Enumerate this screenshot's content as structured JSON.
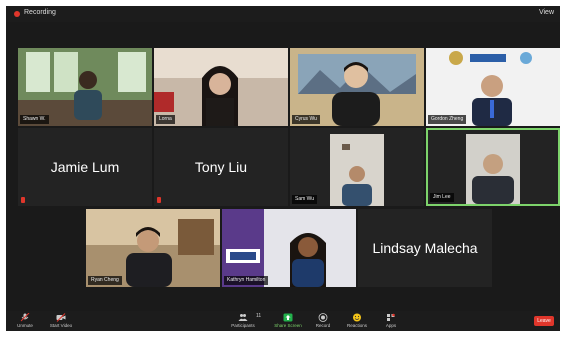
{
  "header": {
    "recording_label": "Recording",
    "view_label": "View"
  },
  "participants": [
    {
      "name": "Shawn W.",
      "type": "video"
    },
    {
      "name": "Lorna",
      "type": "video"
    },
    {
      "name": "Cyrus Wu",
      "type": "video"
    },
    {
      "name": "Gordon Zheng",
      "type": "video"
    },
    {
      "name": "Jamie Lum",
      "type": "name_only"
    },
    {
      "name": "Tony Liu",
      "type": "name_only"
    },
    {
      "name": "Sam Wu",
      "type": "video"
    },
    {
      "name": "Jim Lee",
      "type": "video",
      "active_speaker": true
    },
    {
      "name": "Ryan Cheng",
      "type": "video"
    },
    {
      "name": "Kathryn Hamilton",
      "type": "video"
    },
    {
      "name": "Lindsay Malecha",
      "type": "name_only"
    }
  ],
  "toolbar": {
    "unmute_label": "Unmute",
    "video_label": "Start Video",
    "participants_label": "Participants",
    "participants_count": "11",
    "share_label": "Share Screen",
    "record_label": "Record",
    "reactions_label": "Reactions",
    "apps_label": "Apps",
    "leave_label": "Leave"
  },
  "colors": {
    "active_border": "#7dd36b",
    "leave_red": "#e0362b",
    "share_green": "#22b14c"
  }
}
